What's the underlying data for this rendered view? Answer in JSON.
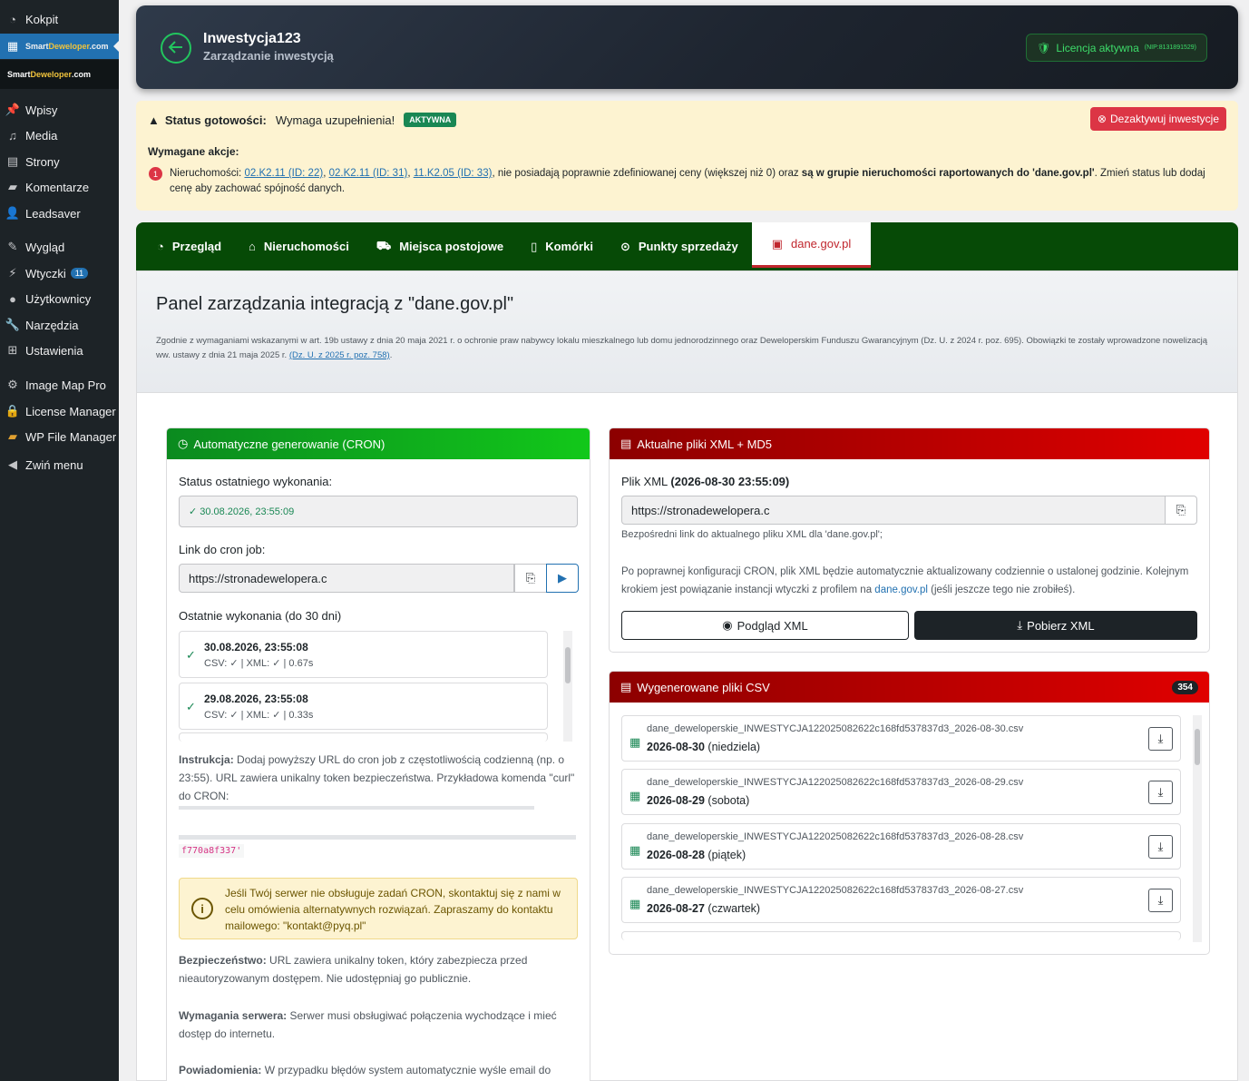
{
  "sidebar": {
    "items": [
      {
        "label": "Kokpit",
        "icon": "dashboard-icon"
      },
      {
        "label": "SmartDeweloper.com",
        "icon": "building-icon"
      },
      {
        "label": "Wpisy",
        "icon": "pin-icon"
      },
      {
        "label": "Media",
        "icon": "media-icon"
      },
      {
        "label": "Strony",
        "icon": "page-icon"
      },
      {
        "label": "Komentarze",
        "icon": "comment-icon"
      },
      {
        "label": "Leadsaver",
        "icon": "user-add-icon"
      },
      {
        "label": "Wygląd",
        "icon": "brush-icon"
      },
      {
        "label": "Wtyczki",
        "icon": "plugin-icon",
        "badge": "11"
      },
      {
        "label": "Użytkownicy",
        "icon": "user-icon"
      },
      {
        "label": "Narzędzia",
        "icon": "wrench-icon"
      },
      {
        "label": "Ustawienia",
        "icon": "settings-icon"
      },
      {
        "label": "Image Map Pro",
        "icon": "gear-icon"
      },
      {
        "label": "License Manager",
        "icon": "lock-icon"
      },
      {
        "label": "WP File Manager",
        "icon": "folder-icon"
      },
      {
        "label": "Zwiń menu",
        "icon": "collapse-icon"
      }
    ],
    "brand_left": "Smart",
    "brand_right": "Deweloper",
    "brand_tld": ".com"
  },
  "header": {
    "title": "Inwestycja123",
    "subtitle": "Zarządzanie inwestycją",
    "license_label": "Licencja aktywna",
    "license_nip": "(NIP:8131891529)"
  },
  "status": {
    "label": "Status gotowości:",
    "value": "Wymaga uzupełnienia!",
    "badge": "AKTYWNA",
    "deactivate": "Dezaktywuj inwestycje",
    "required_title": "Wymagane akcje:",
    "num": "1",
    "msg_prefix": "Nieruchomości: ",
    "links": [
      "02.K2.11 (ID: 22)",
      "02.K2.11 (ID: 31)",
      "11.K2.05 (ID: 33)"
    ],
    "msg_mid": ", nie posiadają poprawnie zdefiniowanej ceny (większej niż 0) oraz ",
    "msg_bold": "są w grupie nieruchomości raportowanych do 'dane.gov.pl'",
    "msg_suffix": ". Zmień status lub dodaj cenę aby zachować spójność danych."
  },
  "tabs": [
    {
      "label": "Przegląd",
      "icon": "chart-icon"
    },
    {
      "label": "Nieruchomości",
      "icon": "house-icon"
    },
    {
      "label": "Miejsca postojowe",
      "icon": "car-icon"
    },
    {
      "label": "Komórki",
      "icon": "door-icon"
    },
    {
      "label": "Punkty sprzedaży",
      "icon": "location-icon"
    },
    {
      "label": "dane.gov.pl",
      "icon": "clipboard-icon",
      "active": true
    }
  ],
  "panel": {
    "title": "Panel zarządzania integracją z \"dane.gov.pl\"",
    "desc": "Zgodnie z wymaganiami wskazanymi w art. 19b ustawy z dnia 20 maja 2021 r. o ochronie praw nabywcy lokalu mieszkalnego lub domu jednorodzinnego oraz Deweloperskim Funduszu Gwarancyjnym (Dz. U. z 2024 r. poz. 695). Obowiązki te zostały wprowadzone nowelizacją ww. ustawy z dnia 21 maja 2025 r. ",
    "desc_link": "(Dz. U. z 2025 r. poz. 758)",
    "desc_end": "."
  },
  "cron": {
    "title": "Automatyczne generowanie (CRON)",
    "status_label": "Status ostatniego wykonania:",
    "status_value": "30.08.2026, 23:55:09",
    "link_label": "Link do cron job:",
    "link_value": "https://stronadewelopera.c",
    "history_label": "Ostatnie wykonania (do 30 dni)",
    "history": [
      {
        "date": "30.08.2026, 23:55:08",
        "detail": "CSV: ✓ | XML: ✓ | 0.67s"
      },
      {
        "date": "29.08.2026, 23:55:08",
        "detail": "CSV: ✓ | XML: ✓ | 0.33s"
      }
    ],
    "instr_bold": "Instrukcja:",
    "instr": " Dodaj powyższy URL do cron job z częstotliwością codzienną (np. o 23:55). URL zawiera unikalny token bezpieczeństwa. Przykładowa komenda \"curl\" do CRON:",
    "code_tail": "f770a8f337'",
    "warn": "Jeśli Twój serwer nie obsługuje zadań CRON, skontaktuj się z nami w celu omówienia alternatywnych rozwiązań. Zapraszamy do kontaktu mailowego: \"kontakt@pyq.pl\"",
    "sec_bold": "Bezpieczeństwo:",
    "sec": " URL zawiera unikalny token, który zabezpiecza przed nieautoryzowanym dostępem. Nie udostępniaj go publicznie.",
    "req_bold": "Wymagania serwera:",
    "req": " Serwer musi obsługiwać połączenia wychodzące i mieć dostęp do internetu.",
    "notif_bold": "Powiadomienia:",
    "notif": " W przypadku błędów system automatycznie wyśle email do"
  },
  "xml": {
    "title": "Aktualne pliki XML + MD5",
    "file_label": "Plik XML ",
    "file_date": "(2026-08-30 23:55:09)",
    "url": "https://stronadewelopera.c",
    "hint": "Bezpośredni link do aktualnego pliku XML dla 'dane.gov.pl';",
    "info": "Po poprawnej konfiguracji CRON, plik XML będzie automatycznie aktualizowany codziennie o ustalonej godzinie. Kolejnym krokiem jest powiązanie instancji wtyczki z profilem na ",
    "info_link": "dane.gov.pl",
    "info_end": " (jeśli jeszcze tego nie zrobiłeś).",
    "preview": "Podgląd XML",
    "download": "Pobierz XML"
  },
  "csv": {
    "title": "Wygenerowane pliki CSV",
    "count": "354",
    "files": [
      {
        "name": "dane_deweloperskie_INWESTYCJA122025082622c168fd537837d3_2026-08-30.csv",
        "date": "2026-08-30",
        "day": " (niedziela)"
      },
      {
        "name": "dane_deweloperskie_INWESTYCJA122025082622c168fd537837d3_2026-08-29.csv",
        "date": "2026-08-29",
        "day": " (sobota)"
      },
      {
        "name": "dane_deweloperskie_INWESTYCJA122025082622c168fd537837d3_2026-08-28.csv",
        "date": "2026-08-28",
        "day": " (piątek)"
      },
      {
        "name": "dane_deweloperskie_INWESTYCJA122025082622c168fd537837d3_2026-08-27.csv",
        "date": "2026-08-27",
        "day": " (czwartek)"
      }
    ]
  },
  "colors": {
    "accent_green": "#12c81a",
    "accent_red": "#e00000",
    "wp_blue": "#2271b1"
  }
}
